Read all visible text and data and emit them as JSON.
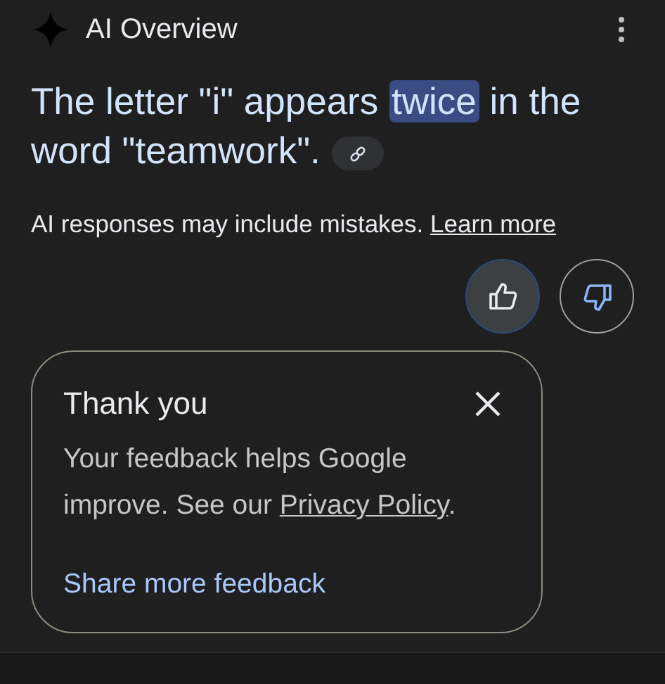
{
  "header": {
    "title": "AI Overview"
  },
  "answer": {
    "before": "The letter \"i\" appears ",
    "highlight": "twice",
    "after": " in the word \"teamwork\"."
  },
  "disclaimer": {
    "text": "AI responses may include mistakes.",
    "link": "Learn more"
  },
  "feedback_buttons": [
    {
      "kind": "up",
      "selected": true
    },
    {
      "kind": "down",
      "selected": false
    }
  ],
  "popup": {
    "title": "Thank you",
    "body": "Your feedback helps Google improve. See our ",
    "link": "Privacy Policy",
    "body_end": ".",
    "action": "Share more feedback"
  }
}
